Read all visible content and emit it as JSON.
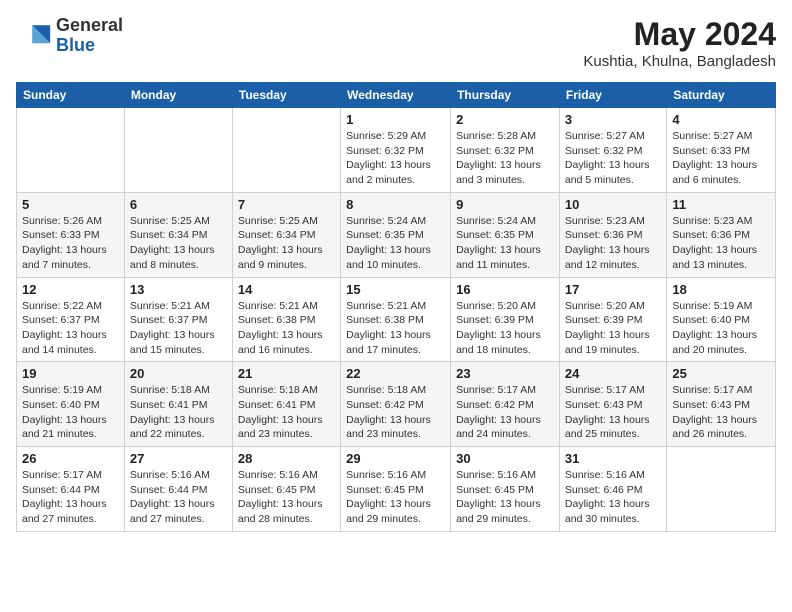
{
  "logo": {
    "general": "General",
    "blue": "Blue"
  },
  "title": {
    "month_year": "May 2024",
    "location": "Kushtia, Khulna, Bangladesh"
  },
  "headers": [
    "Sunday",
    "Monday",
    "Tuesday",
    "Wednesday",
    "Thursday",
    "Friday",
    "Saturday"
  ],
  "weeks": [
    [
      {
        "day": "",
        "info": ""
      },
      {
        "day": "",
        "info": ""
      },
      {
        "day": "",
        "info": ""
      },
      {
        "day": "1",
        "info": "Sunrise: 5:29 AM\nSunset: 6:32 PM\nDaylight: 13 hours\nand 2 minutes."
      },
      {
        "day": "2",
        "info": "Sunrise: 5:28 AM\nSunset: 6:32 PM\nDaylight: 13 hours\nand 3 minutes."
      },
      {
        "day": "3",
        "info": "Sunrise: 5:27 AM\nSunset: 6:32 PM\nDaylight: 13 hours\nand 5 minutes."
      },
      {
        "day": "4",
        "info": "Sunrise: 5:27 AM\nSunset: 6:33 PM\nDaylight: 13 hours\nand 6 minutes."
      }
    ],
    [
      {
        "day": "5",
        "info": "Sunrise: 5:26 AM\nSunset: 6:33 PM\nDaylight: 13 hours\nand 7 minutes."
      },
      {
        "day": "6",
        "info": "Sunrise: 5:25 AM\nSunset: 6:34 PM\nDaylight: 13 hours\nand 8 minutes."
      },
      {
        "day": "7",
        "info": "Sunrise: 5:25 AM\nSunset: 6:34 PM\nDaylight: 13 hours\nand 9 minutes."
      },
      {
        "day": "8",
        "info": "Sunrise: 5:24 AM\nSunset: 6:35 PM\nDaylight: 13 hours\nand 10 minutes."
      },
      {
        "day": "9",
        "info": "Sunrise: 5:24 AM\nSunset: 6:35 PM\nDaylight: 13 hours\nand 11 minutes."
      },
      {
        "day": "10",
        "info": "Sunrise: 5:23 AM\nSunset: 6:36 PM\nDaylight: 13 hours\nand 12 minutes."
      },
      {
        "day": "11",
        "info": "Sunrise: 5:23 AM\nSunset: 6:36 PM\nDaylight: 13 hours\nand 13 minutes."
      }
    ],
    [
      {
        "day": "12",
        "info": "Sunrise: 5:22 AM\nSunset: 6:37 PM\nDaylight: 13 hours\nand 14 minutes."
      },
      {
        "day": "13",
        "info": "Sunrise: 5:21 AM\nSunset: 6:37 PM\nDaylight: 13 hours\nand 15 minutes."
      },
      {
        "day": "14",
        "info": "Sunrise: 5:21 AM\nSunset: 6:38 PM\nDaylight: 13 hours\nand 16 minutes."
      },
      {
        "day": "15",
        "info": "Sunrise: 5:21 AM\nSunset: 6:38 PM\nDaylight: 13 hours\nand 17 minutes."
      },
      {
        "day": "16",
        "info": "Sunrise: 5:20 AM\nSunset: 6:39 PM\nDaylight: 13 hours\nand 18 minutes."
      },
      {
        "day": "17",
        "info": "Sunrise: 5:20 AM\nSunset: 6:39 PM\nDaylight: 13 hours\nand 19 minutes."
      },
      {
        "day": "18",
        "info": "Sunrise: 5:19 AM\nSunset: 6:40 PM\nDaylight: 13 hours\nand 20 minutes."
      }
    ],
    [
      {
        "day": "19",
        "info": "Sunrise: 5:19 AM\nSunset: 6:40 PM\nDaylight: 13 hours\nand 21 minutes."
      },
      {
        "day": "20",
        "info": "Sunrise: 5:18 AM\nSunset: 6:41 PM\nDaylight: 13 hours\nand 22 minutes."
      },
      {
        "day": "21",
        "info": "Sunrise: 5:18 AM\nSunset: 6:41 PM\nDaylight: 13 hours\nand 23 minutes."
      },
      {
        "day": "22",
        "info": "Sunrise: 5:18 AM\nSunset: 6:42 PM\nDaylight: 13 hours\nand 23 minutes."
      },
      {
        "day": "23",
        "info": "Sunrise: 5:17 AM\nSunset: 6:42 PM\nDaylight: 13 hours\nand 24 minutes."
      },
      {
        "day": "24",
        "info": "Sunrise: 5:17 AM\nSunset: 6:43 PM\nDaylight: 13 hours\nand 25 minutes."
      },
      {
        "day": "25",
        "info": "Sunrise: 5:17 AM\nSunset: 6:43 PM\nDaylight: 13 hours\nand 26 minutes."
      }
    ],
    [
      {
        "day": "26",
        "info": "Sunrise: 5:17 AM\nSunset: 6:44 PM\nDaylight: 13 hours\nand 27 minutes."
      },
      {
        "day": "27",
        "info": "Sunrise: 5:16 AM\nSunset: 6:44 PM\nDaylight: 13 hours\nand 27 minutes."
      },
      {
        "day": "28",
        "info": "Sunrise: 5:16 AM\nSunset: 6:45 PM\nDaylight: 13 hours\nand 28 minutes."
      },
      {
        "day": "29",
        "info": "Sunrise: 5:16 AM\nSunset: 6:45 PM\nDaylight: 13 hours\nand 29 minutes."
      },
      {
        "day": "30",
        "info": "Sunrise: 5:16 AM\nSunset: 6:45 PM\nDaylight: 13 hours\nand 29 minutes."
      },
      {
        "day": "31",
        "info": "Sunrise: 5:16 AM\nSunset: 6:46 PM\nDaylight: 13 hours\nand 30 minutes."
      },
      {
        "day": "",
        "info": ""
      }
    ]
  ]
}
